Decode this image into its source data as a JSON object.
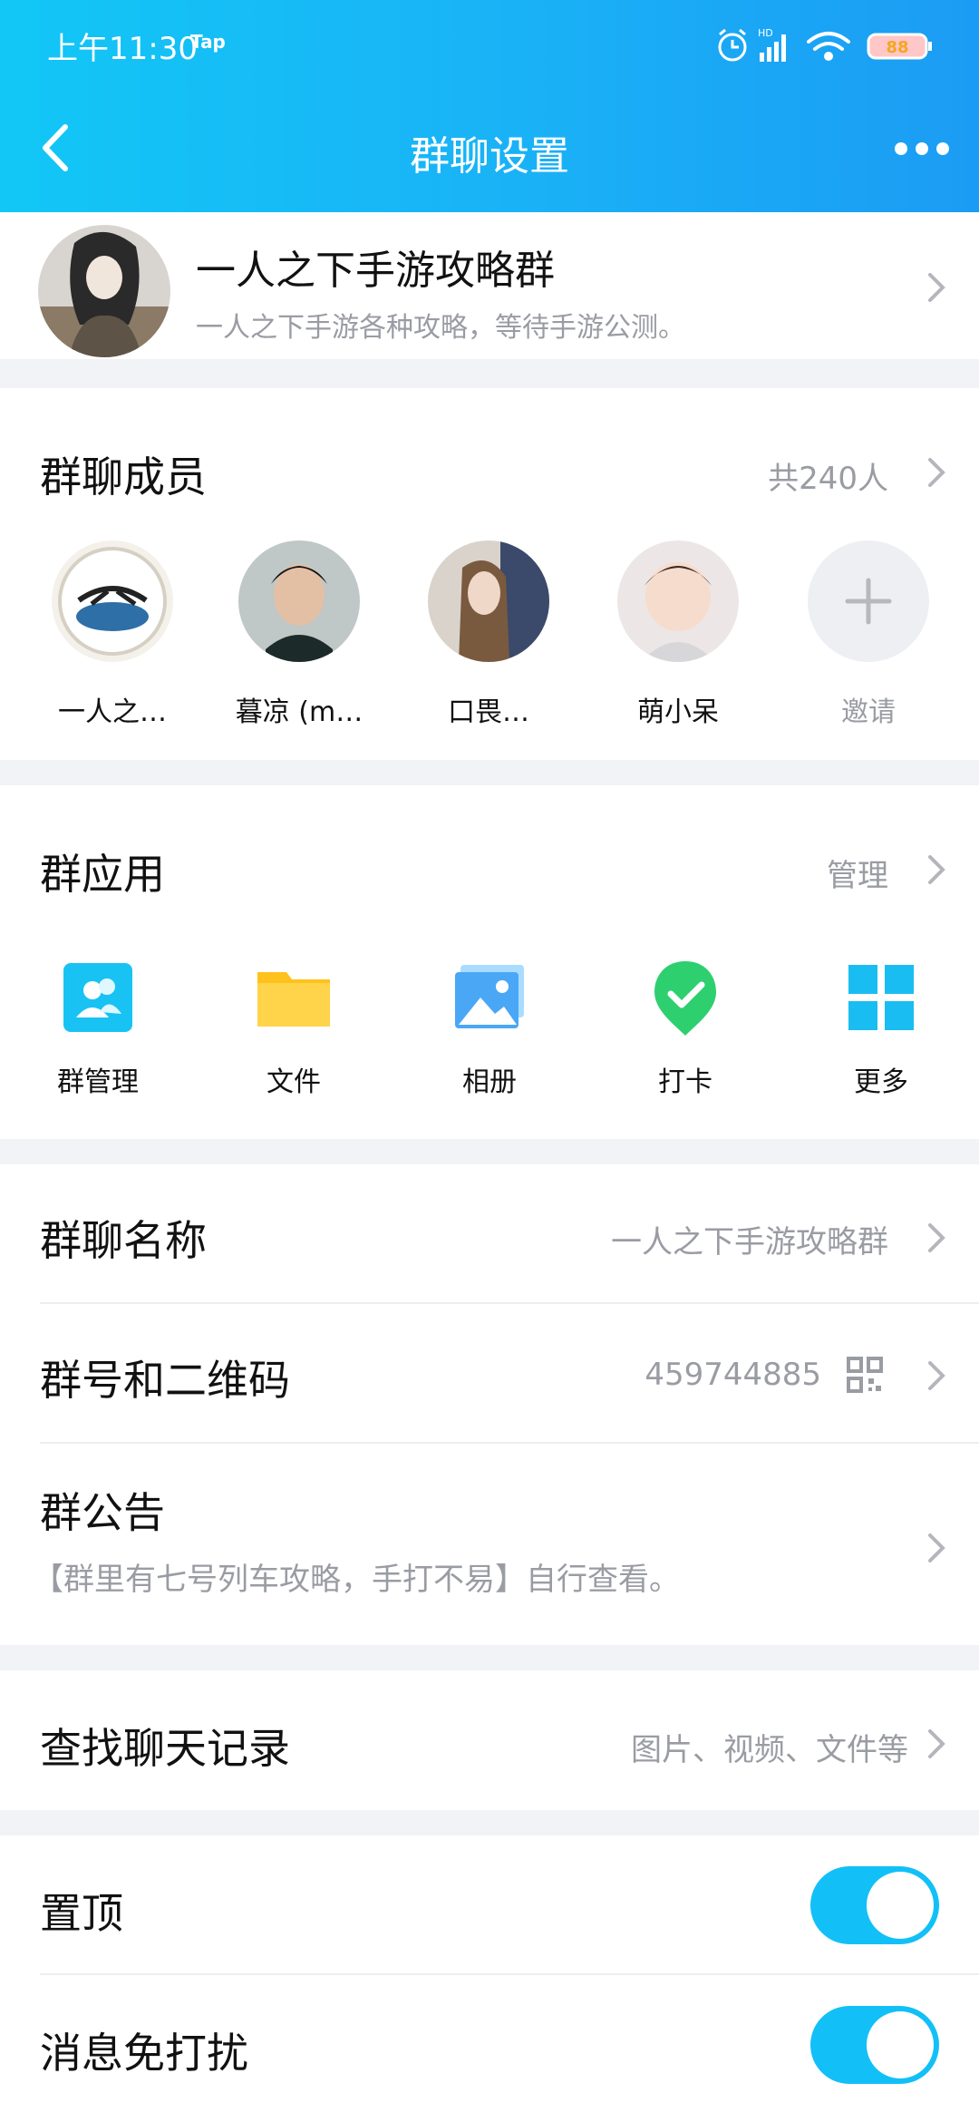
{
  "status_bar": {
    "time": "上午11:30",
    "tap_label": "Tap",
    "battery": "88"
  },
  "header": {
    "title": "群聊设置"
  },
  "group": {
    "name": "一人之下手游攻略群",
    "description": "一人之下手游各种攻略，等待手游公测。"
  },
  "members": {
    "title": "群聊成员",
    "count_label": "共240人",
    "items": [
      {
        "name": "一人之…"
      },
      {
        "name": "暮凉 (m…"
      },
      {
        "name": "口畏…"
      },
      {
        "name": "萌小呆"
      }
    ],
    "invite_label": "邀请"
  },
  "apps": {
    "title": "群应用",
    "manage_label": "管理",
    "items": [
      {
        "label": "群管理",
        "icon": "group-manage-icon"
      },
      {
        "label": "文件",
        "icon": "folder-icon"
      },
      {
        "label": "相册",
        "icon": "album-icon"
      },
      {
        "label": "打卡",
        "icon": "checkin-icon"
      },
      {
        "label": "更多",
        "icon": "more-grid-icon"
      }
    ]
  },
  "settings": {
    "group_name_label": "群聊名称",
    "group_name_value": "一人之下手游攻略群",
    "group_number_label": "群号和二维码",
    "group_number_value": "459744885",
    "notice_label": "群公告",
    "notice_text": "【群里有七号列车攻略，手打不易】自行查看。",
    "search_label": "查找聊天记录",
    "search_hint": "图片、视频、文件等",
    "pin_label": "置顶",
    "mute_label": "消息免打扰"
  },
  "toggles": {
    "pin_on": true,
    "mute_on": true
  },
  "colors": {
    "accent": "#12c0f7",
    "header_start": "#12c7f6",
    "header_end": "#1b9cf4",
    "muted_text": "#9a9ca3"
  }
}
